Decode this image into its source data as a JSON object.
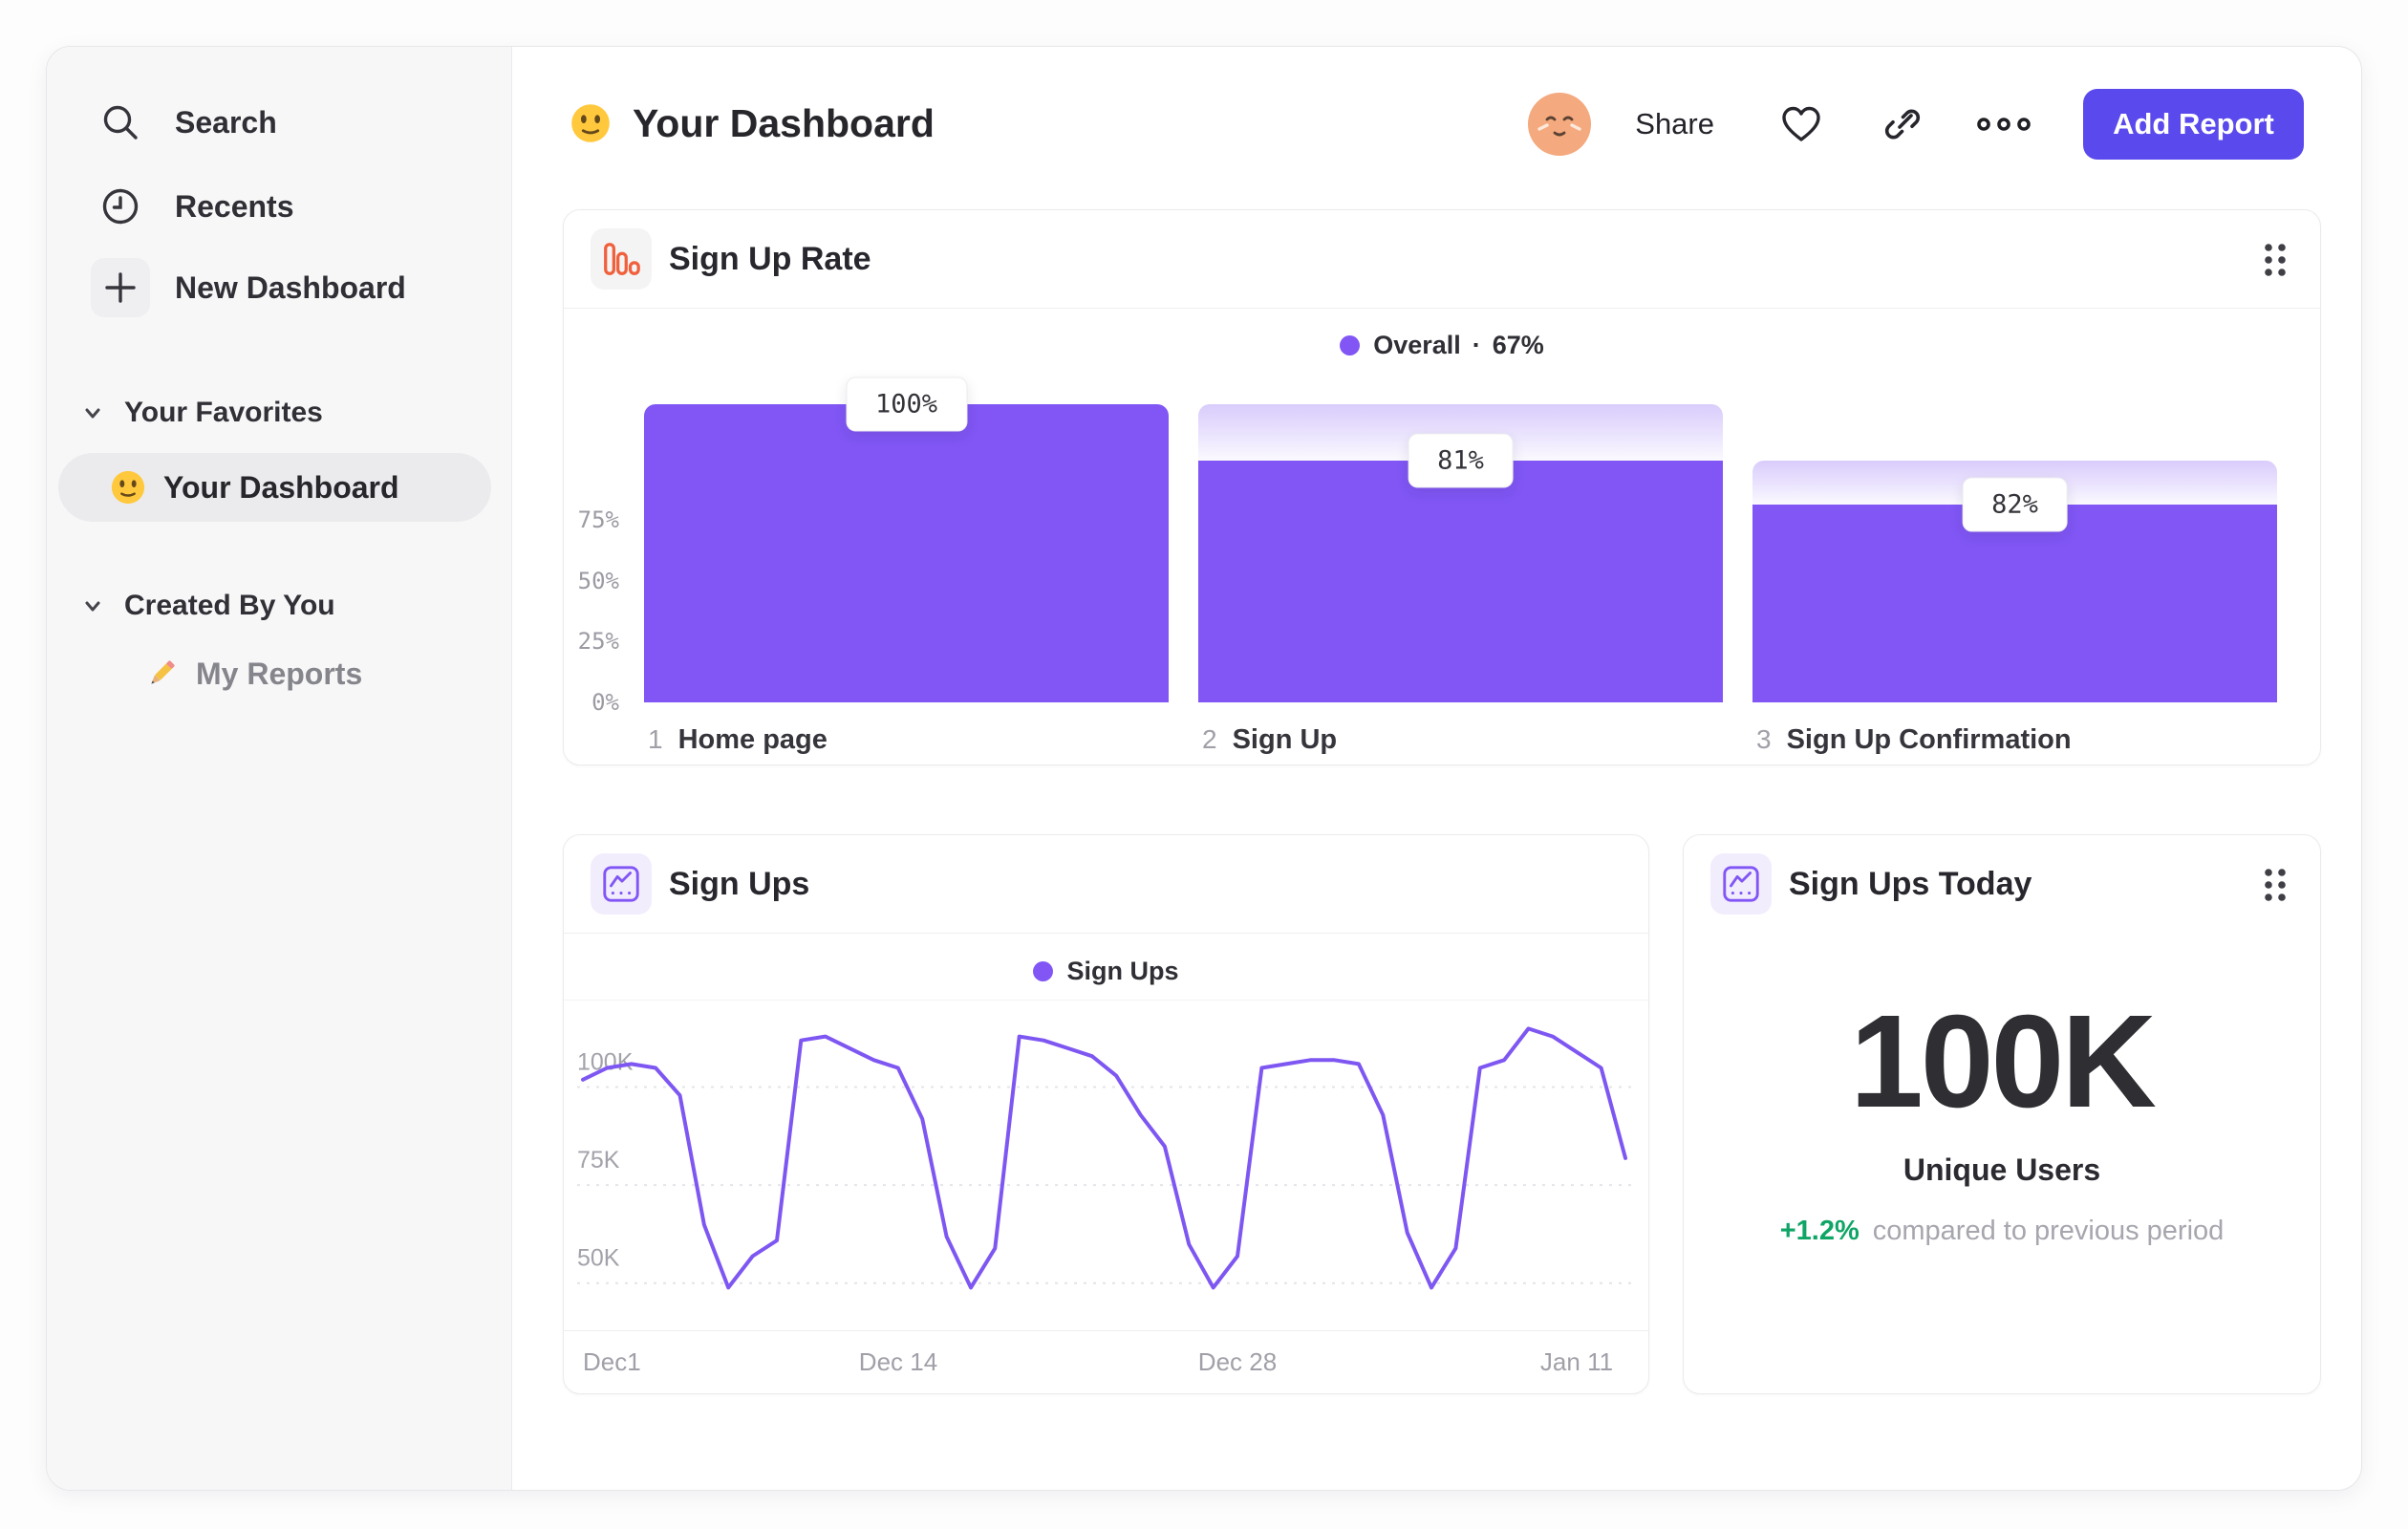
{
  "colors": {
    "accent_purple": "#8156F5",
    "line_purple": "#7E57F2",
    "button_indigo": "#5A49EC",
    "icon_orange": "#F0603C",
    "positive_green": "#0FA566"
  },
  "sidebar": {
    "items": [
      {
        "label": "Search",
        "icon": "search-icon"
      },
      {
        "label": "Recents",
        "icon": "clock-icon"
      },
      {
        "label": "New Dashboard",
        "icon": "plus-icon"
      }
    ],
    "sections": [
      {
        "title": "Your Favorites",
        "items": [
          {
            "label": "Your Dashboard",
            "icon": "smiley-emoji",
            "selected": true
          }
        ]
      },
      {
        "title": "Created By You",
        "items": [
          {
            "label": "My Reports",
            "icon": "pencil-emoji",
            "selected": false
          }
        ]
      }
    ]
  },
  "header": {
    "title": "Your Dashboard",
    "title_emoji": "smiley-emoji",
    "share_label": "Share",
    "icons": [
      "avatar",
      "heart-icon",
      "link-icon",
      "ellipsis-icon"
    ],
    "add_report_label": "Add Report"
  },
  "cards": {
    "metric": {
      "title": "Sign Ups Today",
      "value": "100K",
      "label": "Unique Users",
      "delta": "+1.2%",
      "delta_note": "compared to previous period"
    }
  },
  "chart_data": [
    {
      "type": "bar",
      "subtype": "funnel",
      "title": "Sign Up Rate",
      "legend": {
        "series": "Overall",
        "separator": "·",
        "value": "67%"
      },
      "y_ticks": [
        {
          "label": "75%",
          "value": 75
        },
        {
          "label": "50%",
          "value": 50
        },
        {
          "label": "25%",
          "value": 25
        },
        {
          "label": "0%",
          "value": 0
        }
      ],
      "ylim": [
        0,
        100
      ],
      "steps": [
        {
          "index": "1",
          "name": "Home page",
          "step_conversion_label": "100%",
          "step_conversion_pct": 100,
          "cumulative_pct": 100
        },
        {
          "index": "2",
          "name": "Sign Up",
          "step_conversion_label": "81%",
          "step_conversion_pct": 81,
          "cumulative_pct": 81
        },
        {
          "index": "3",
          "name": "Sign Up Confirmation",
          "step_conversion_label": "82%",
          "step_conversion_pct": 82,
          "cumulative_pct": 66.4
        }
      ]
    },
    {
      "type": "line",
      "title": "Sign Ups",
      "legend": "Sign Ups",
      "unit": "K users",
      "grid": "dashed-horizontal",
      "ylim": [
        38,
        114
      ],
      "y_ticks": [
        {
          "label": "100K",
          "value": 100
        },
        {
          "label": "75K",
          "value": 75
        },
        {
          "label": "50K",
          "value": 50
        }
      ],
      "x_tick_labels": [
        "Dec1",
        "Dec 14",
        "Dec 28",
        "Jan 11"
      ],
      "x_tick_indexes": [
        0,
        13,
        27,
        41
      ],
      "values_thousands": [
        97,
        100,
        101,
        100,
        93,
        60,
        44,
        52,
        56,
        107,
        108,
        105,
        102,
        100,
        87,
        57,
        44,
        54,
        108,
        107,
        105,
        103,
        98,
        88,
        80,
        55,
        44,
        52,
        100,
        101,
        102,
        102,
        101,
        88,
        58,
        44,
        54,
        100,
        102,
        110,
        108,
        104,
        100,
        77
      ]
    }
  ]
}
